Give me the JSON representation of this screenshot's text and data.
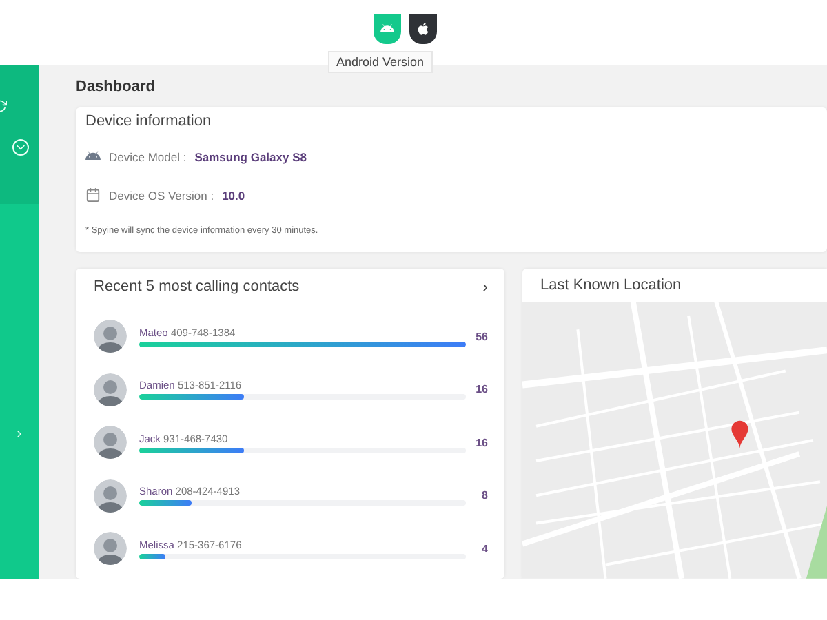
{
  "platform_tabs": [
    {
      "kind": "android",
      "selected": true
    },
    {
      "kind": "apple",
      "selected": false
    }
  ],
  "tooltip": "Android Version",
  "page_title": "Dashboard",
  "device_info": {
    "title": "Device information",
    "rows": [
      {
        "kind": "model",
        "label": "Device Model :",
        "value": "Samsung Galaxy S8"
      },
      {
        "kind": "os",
        "label": "Device OS Version :",
        "value": "10.0"
      }
    ],
    "note": "* Spyine will sync the device information every 30 minutes."
  },
  "contacts": {
    "title": "Recent 5 most calling contacts",
    "more": "›",
    "rows": [
      {
        "name": "Mateo",
        "phone": "409-748-1384",
        "level": 1,
        "count": "56"
      },
      {
        "name": "Damien",
        "phone": "513-851-2116",
        "level": 0.32,
        "count": "16"
      },
      {
        "name": "Jack",
        "phone": "931-468-7430",
        "level": 0.32,
        "count": "16"
      },
      {
        "name": "Sharon",
        "phone": "208-424-4913",
        "level": 0.16,
        "count": "8"
      },
      {
        "name": "Melissa",
        "phone": "215-367-6176",
        "level": 0.08,
        "count": "4"
      }
    ]
  },
  "location": {
    "title": "Last Known Location"
  }
}
